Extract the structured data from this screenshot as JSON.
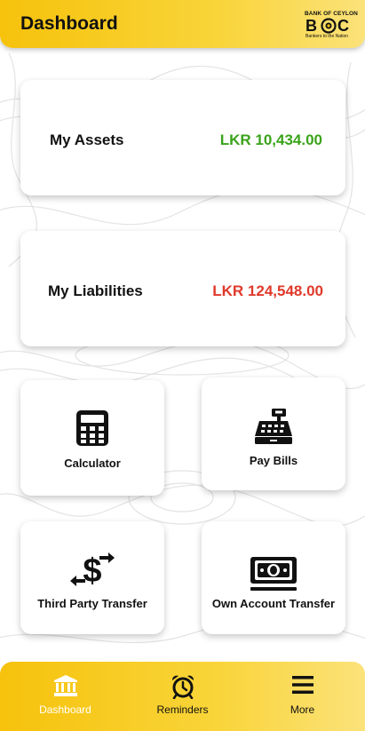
{
  "header": {
    "title": "Dashboard"
  },
  "logo": {
    "text_top": "BANK OF CEYLON",
    "wordmark": "BOC",
    "tagline": "Bankers to the Nation"
  },
  "summary": {
    "assets": {
      "label": "My Assets",
      "value": "LKR 10,434.00",
      "color": "#3aa31a"
    },
    "liabilities": {
      "label": "My Liabilities",
      "value": "LKR 124,548.00",
      "color": "#e0392b"
    }
  },
  "tiles": [
    {
      "label": "Calculator",
      "icon": "calculator-icon"
    },
    {
      "label": "Pay Bills",
      "icon": "cash-register-icon"
    },
    {
      "label": "Third Party Transfer",
      "icon": "dollar-transfer-icon"
    },
    {
      "label": "Own Account Transfer",
      "icon": "money-bill-icon"
    }
  ],
  "bottom_nav": {
    "items": [
      {
        "label": "Dashboard",
        "icon": "bank-icon",
        "active": true
      },
      {
        "label": "Reminders",
        "icon": "alarm-clock-icon",
        "active": false
      },
      {
        "label": "More",
        "icon": "menu-icon",
        "active": false
      }
    ]
  },
  "colors": {
    "accent": "#f6c20c",
    "accent_light": "#fbe27a"
  }
}
